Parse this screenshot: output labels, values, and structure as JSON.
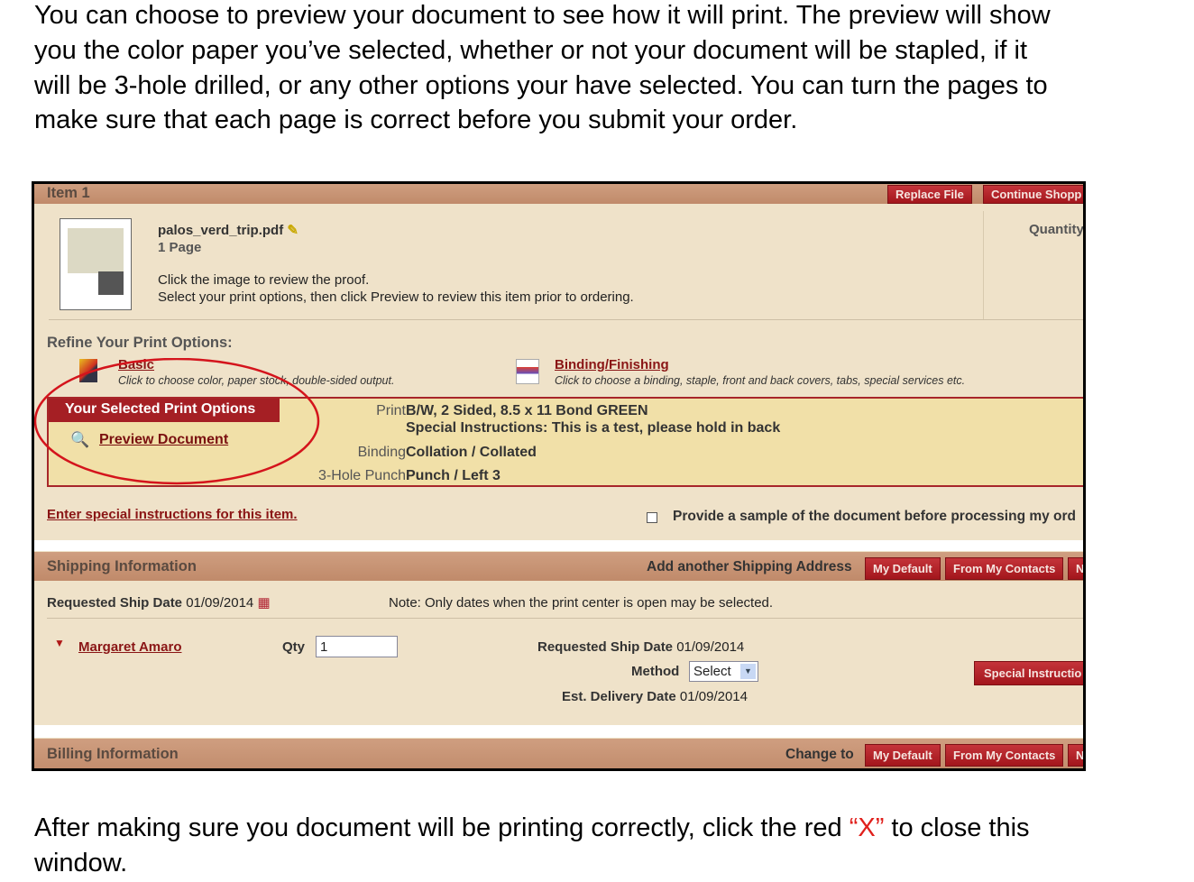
{
  "intro_lines": [
    "You can choose to preview your document to see how it will print.  The preview will show",
    "you the color paper you’ve selected, whether or not your document will be stapled, if it",
    "will be 3-hole drilled, or any other options your have selected.  You can turn the pages to",
    "make sure that each page is correct before you submit your order."
  ],
  "outro": {
    "before": "After making sure you document will be printing correctly, click the red ",
    "highlight": "“X”",
    "after": " to close this",
    "line2": "window."
  },
  "item": {
    "title": "Item 1",
    "replace_file": "Replace File",
    "continue_shopping": "Continue Shopp",
    "quantity_label": "Quantity",
    "file_name": "palos_verd_trip.pdf",
    "pages": "1 Page",
    "hint1": "Click the image to review the proof.",
    "hint2": "Select your print options, then click Preview to review this item prior to ordering."
  },
  "refine": {
    "title": "Refine Your Print Options:",
    "basic_label": "Basic",
    "basic_desc": "Click to choose color, paper stock, double-sided output.",
    "binding_label": "Binding/Finishing",
    "binding_desc": "Click to choose a binding, staple, front and back covers, tabs, special services etc."
  },
  "selected": {
    "header": "Your Selected Print Options",
    "preview": "Preview Document",
    "rows": [
      {
        "label": "Print",
        "value": "B/W, 2 Sided, 8.5 x 11 Bond GREEN"
      },
      {
        "label": "",
        "value": "Special Instructions: This is a test, please hold in back"
      },
      {
        "label": "Binding",
        "value": "Collation / Collated"
      },
      {
        "label": "3-Hole Punch",
        "value": "Punch / Left 3"
      }
    ]
  },
  "special_instructions_link": "Enter special instructions for this item.",
  "sample_checkbox": {
    "label": "Provide a sample of the document before processing my ord",
    "checked": false
  },
  "shipping": {
    "title": "Shipping Information",
    "add_label": "Add another Shipping Address",
    "btn_default": "My Default",
    "btn_contacts": "From My Contacts",
    "btn_new": "N",
    "ship_date_label": "Requested Ship Date",
    "ship_date": "01/09/2014",
    "note": "Note: Only dates when the print center is open may be selected.",
    "recipient": "Margaret Amaro",
    "qty_label": "Qty",
    "qty_value": "1",
    "req_label": "Requested Ship Date",
    "req_value": "01/09/2014",
    "method_label": "Method",
    "method_value": "Select",
    "est_label": "Est. Delivery Date",
    "est_value": "01/09/2014",
    "special_btn": "Special Instructio"
  },
  "billing": {
    "title": "Billing Information",
    "change_label": "Change to",
    "btn_default": "My Default",
    "btn_contacts": "From My Contacts",
    "btn_new": "N"
  },
  "colors": {
    "header_bar": "#c89272",
    "panel": "#efe2c9",
    "button": "#b0222a",
    "link": "#8a1515",
    "annotation_circle": "#d4141c"
  }
}
